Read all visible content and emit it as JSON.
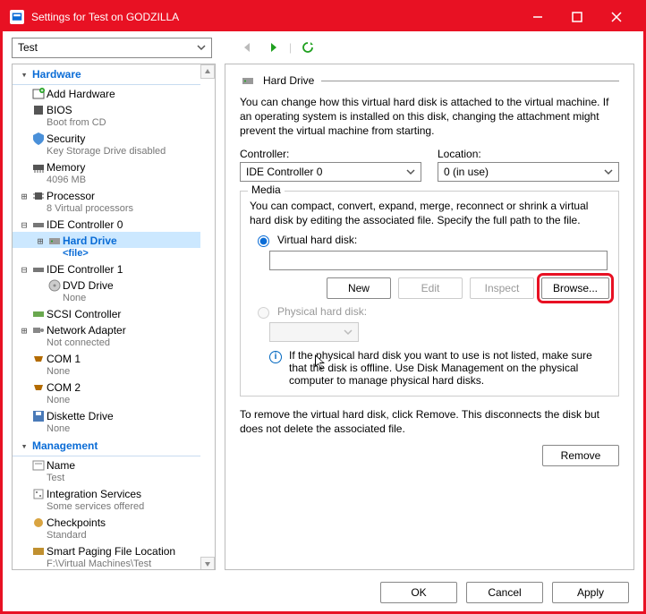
{
  "window": {
    "title": "Settings for Test on GODZILLA"
  },
  "toolbar": {
    "selector_value": "Test"
  },
  "tree": {
    "hardware": {
      "label": "Hardware",
      "items": [
        {
          "label": "Add Hardware",
          "sub": ""
        },
        {
          "label": "BIOS",
          "sub": "Boot from CD"
        },
        {
          "label": "Security",
          "sub": "Key Storage Drive disabled"
        },
        {
          "label": "Memory",
          "sub": "4096 MB"
        },
        {
          "label": "Processor",
          "sub": "8 Virtual processors"
        },
        {
          "label": "IDE Controller 0",
          "sub": "",
          "children": [
            {
              "label": "Hard Drive",
              "sub": "<file>",
              "selected": true
            }
          ]
        },
        {
          "label": "IDE Controller 1",
          "sub": "",
          "children": [
            {
              "label": "DVD Drive",
              "sub": "None"
            }
          ]
        },
        {
          "label": "SCSI Controller",
          "sub": ""
        },
        {
          "label": "Network Adapter",
          "sub": "Not connected"
        },
        {
          "label": "COM 1",
          "sub": "None"
        },
        {
          "label": "COM 2",
          "sub": "None"
        },
        {
          "label": "Diskette Drive",
          "sub": "None"
        }
      ]
    },
    "management": {
      "label": "Management",
      "items": [
        {
          "label": "Name",
          "sub": "Test"
        },
        {
          "label": "Integration Services",
          "sub": "Some services offered"
        },
        {
          "label": "Checkpoints",
          "sub": "Standard"
        },
        {
          "label": "Smart Paging File Location",
          "sub": "F:\\Virtual Machines\\Test"
        }
      ]
    }
  },
  "detail": {
    "section_title": "Hard Drive",
    "intro": "You can change how this virtual hard disk is attached to the virtual machine. If an operating system is installed on this disk, changing the attachment might prevent the virtual machine from starting.",
    "controller_label": "Controller:",
    "controller_value": "IDE Controller 0",
    "location_label": "Location:",
    "location_value": "0 (in use)",
    "media": {
      "title": "Media",
      "hint": "You can compact, convert, expand, merge, reconnect or shrink a virtual hard disk by editing the associated file. Specify the full path to the file.",
      "radio_virtual": "Virtual hard disk:",
      "radio_physical": "Physical hard disk:",
      "path_value": "",
      "btn_new": "New",
      "btn_edit": "Edit",
      "btn_inspect": "Inspect",
      "btn_browse": "Browse...",
      "phys_info": "If the physical hard disk you want to use is not listed, make sure that the disk is offline. Use Disk Management on the physical computer to manage physical hard disks."
    },
    "remove_text": "To remove the virtual hard disk, click Remove. This disconnects the disk but does not delete the associated file.",
    "btn_remove": "Remove"
  },
  "footer": {
    "ok": "OK",
    "cancel": "Cancel",
    "apply": "Apply"
  }
}
